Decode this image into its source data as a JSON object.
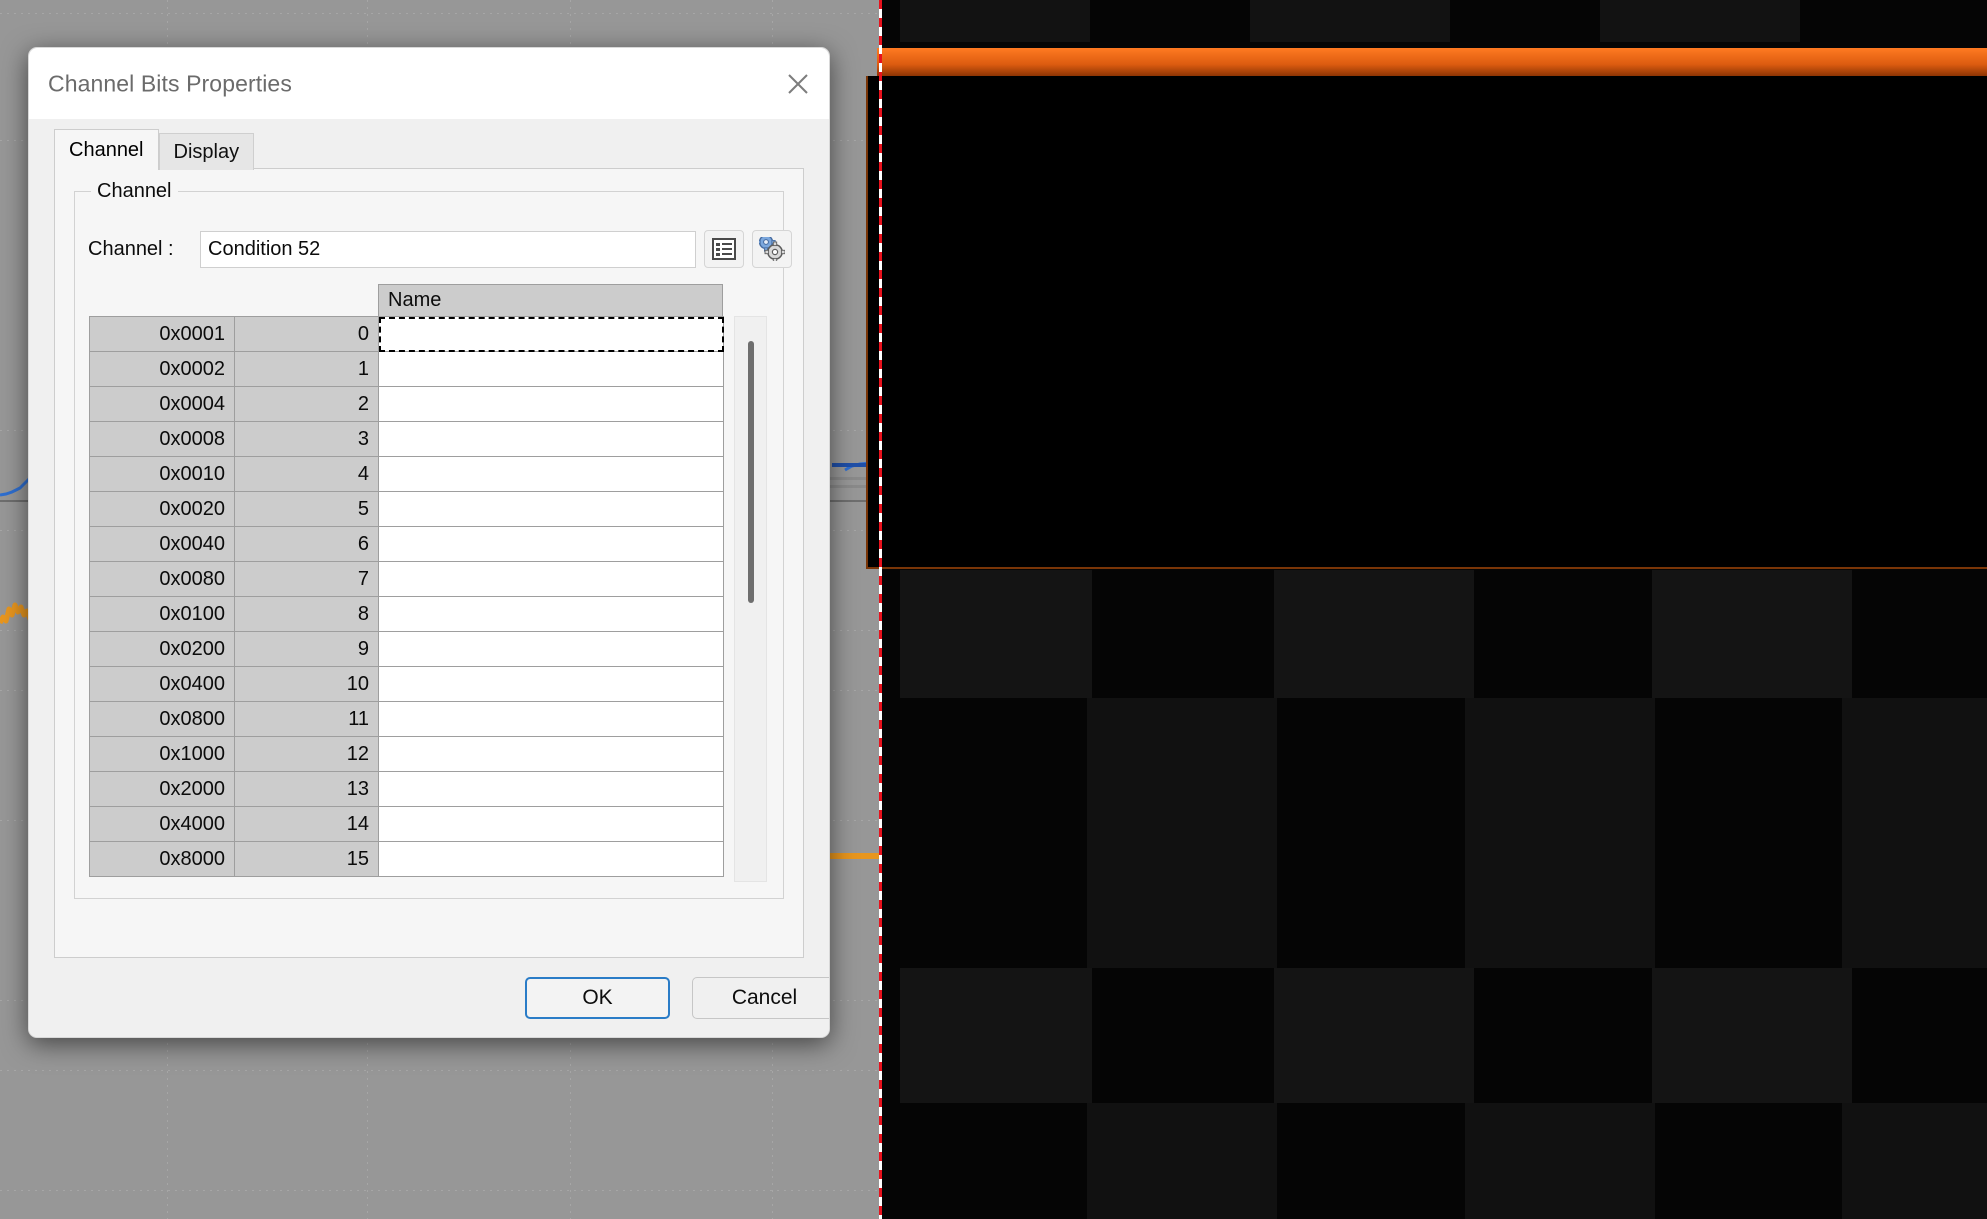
{
  "dialog": {
    "title": "Channel Bits Properties",
    "close_icon": "close-icon",
    "tabs": [
      {
        "label": "Channel",
        "active": true
      },
      {
        "label": "Display",
        "active": false
      }
    ],
    "group": {
      "legend": "Channel",
      "field_label": "Channel :",
      "field_value": "Condition 52",
      "field_placeholder": "",
      "buttons": [
        {
          "icon": "list-icon",
          "name": "channel-list-button"
        },
        {
          "icon": "gears-icon",
          "name": "channel-settings-button"
        }
      ]
    },
    "table": {
      "columns": [
        "",
        "",
        "Name"
      ],
      "header_name": "Name",
      "rows": [
        {
          "mask": "0x0001",
          "bit": "0",
          "name": "",
          "focused": true
        },
        {
          "mask": "0x0002",
          "bit": "1",
          "name": "",
          "focused": false
        },
        {
          "mask": "0x0004",
          "bit": "2",
          "name": "",
          "focused": false
        },
        {
          "mask": "0x0008",
          "bit": "3",
          "name": "",
          "focused": false
        },
        {
          "mask": "0x0010",
          "bit": "4",
          "name": "",
          "focused": false
        },
        {
          "mask": "0x0020",
          "bit": "5",
          "name": "",
          "focused": false
        },
        {
          "mask": "0x0040",
          "bit": "6",
          "name": "",
          "focused": false
        },
        {
          "mask": "0x0080",
          "bit": "7",
          "name": "",
          "focused": false
        },
        {
          "mask": "0x0100",
          "bit": "8",
          "name": "",
          "focused": false
        },
        {
          "mask": "0x0200",
          "bit": "9",
          "name": "",
          "focused": false
        },
        {
          "mask": "0x0400",
          "bit": "10",
          "name": "",
          "focused": false
        },
        {
          "mask": "0x0800",
          "bit": "11",
          "name": "",
          "focused": false
        },
        {
          "mask": "0x1000",
          "bit": "12",
          "name": "",
          "focused": false
        },
        {
          "mask": "0x2000",
          "bit": "13",
          "name": "",
          "focused": false
        },
        {
          "mask": "0x4000",
          "bit": "14",
          "name": "",
          "focused": false
        },
        {
          "mask": "0x8000",
          "bit": "15",
          "name": "",
          "focused": false
        }
      ]
    },
    "footer": {
      "ok_label": "OK",
      "cancel_label": "Cancel"
    }
  },
  "background": {
    "colors": {
      "canvas": "#000000",
      "grid_dot": "#b0b0b0",
      "orange_bar_top": "#ff7a22",
      "orange_bar_bottom": "#8d3404",
      "panel_border": "#7a3507",
      "trace_blue": "#2f6fd0",
      "trace_orange": "#e8961e",
      "cursor_red": "#e8121d",
      "cursor_white": "#ffffff",
      "checker_light": "#141414",
      "checker_dark": "#000000"
    }
  }
}
